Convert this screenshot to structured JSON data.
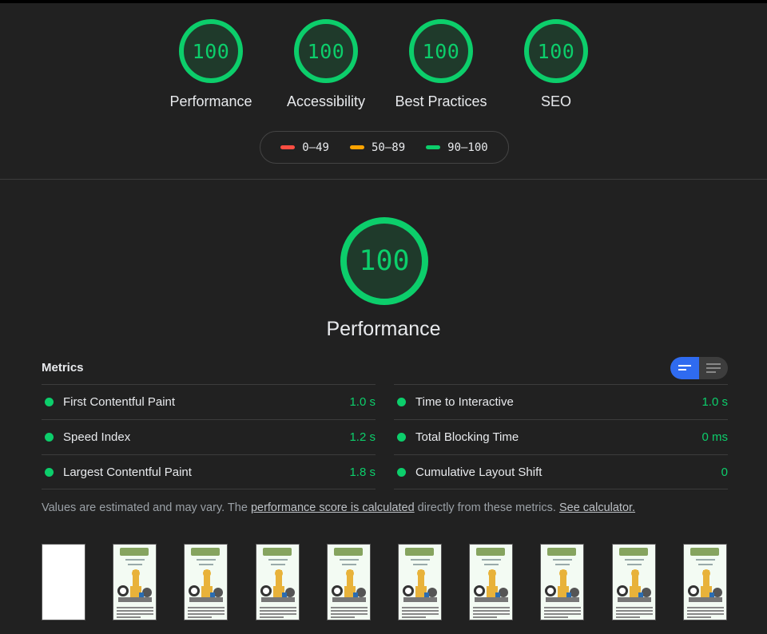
{
  "categories": [
    {
      "score": "100",
      "label": "Performance"
    },
    {
      "score": "100",
      "label": "Accessibility"
    },
    {
      "score": "100",
      "label": "Best Practices"
    },
    {
      "score": "100",
      "label": "SEO"
    }
  ],
  "legend": [
    {
      "range": "0–49",
      "color": "#ff4e42"
    },
    {
      "range": "50–89",
      "color": "#ffa400"
    },
    {
      "range": "90–100",
      "color": "#0cce6b"
    }
  ],
  "performance": {
    "score": "100",
    "label": "Performance"
  },
  "metrics": {
    "title": "Metrics",
    "items": [
      {
        "name": "First Contentful Paint",
        "value": "1.0 s"
      },
      {
        "name": "Time to Interactive",
        "value": "1.0 s"
      },
      {
        "name": "Speed Index",
        "value": "1.2 s"
      },
      {
        "name": "Total Blocking Time",
        "value": "0 ms"
      },
      {
        "name": "Largest Contentful Paint",
        "value": "1.8 s"
      },
      {
        "name": "Cumulative Layout Shift",
        "value": "0"
      }
    ]
  },
  "note": {
    "prefix": "Values are estimated and may vary. The ",
    "link1": "performance score is calculated",
    "middle": " directly from these metrics. ",
    "link2": "See calculator."
  },
  "colors": {
    "pass": "#0cce6b",
    "toggle_active": "#2f6bf0"
  }
}
